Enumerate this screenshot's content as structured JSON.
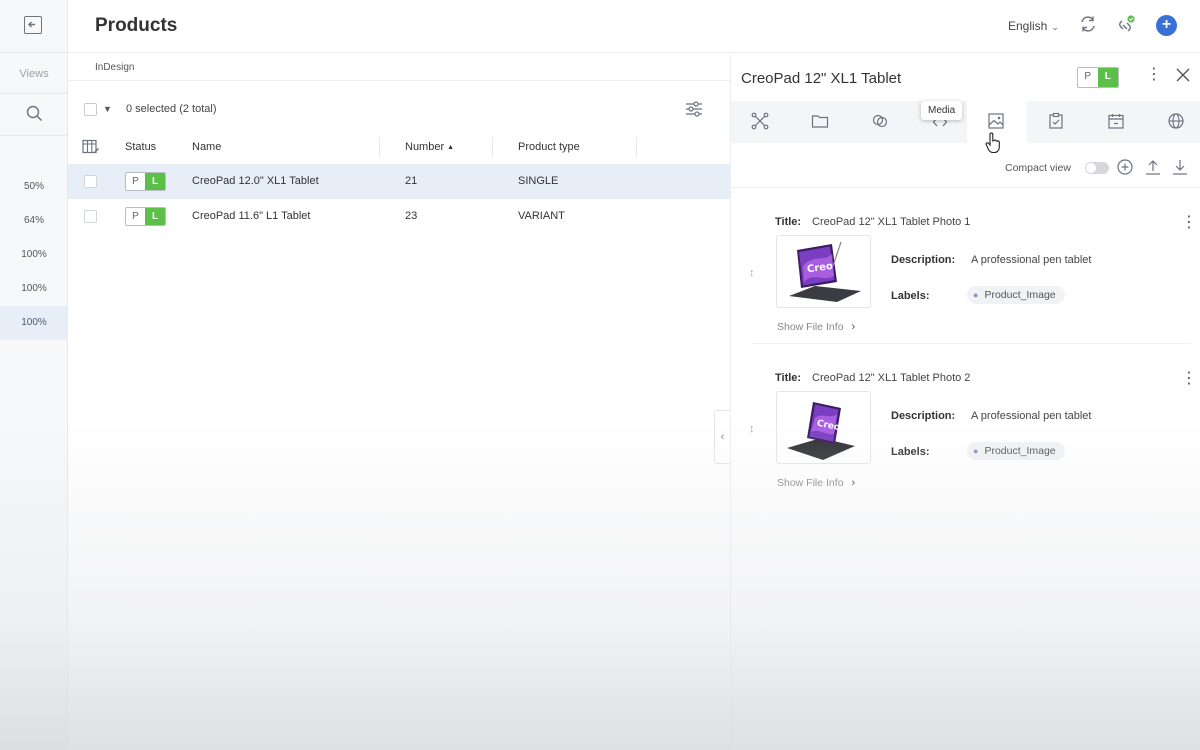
{
  "header": {
    "title": "Products",
    "language": "English"
  },
  "sidebar": {
    "views_label": "Views",
    "zoom_levels": [
      "50%",
      "64%",
      "100%",
      "100%",
      "100%"
    ]
  },
  "breadcrumb": "InDesign",
  "list": {
    "selection_text": "0 selected (2 total)",
    "columns": {
      "status": "Status",
      "name": "Name",
      "number": "Number",
      "product_type": "Product type"
    },
    "sorted_column": "number",
    "rows": [
      {
        "status_p": "P",
        "status_l": "L",
        "name": "CreoPad 12.0\" XL1 Tablet",
        "number": "21",
        "product_type": "SINGLE",
        "selected": true
      },
      {
        "status_p": "P",
        "status_l": "L",
        "name": "CreoPad 11.6\" L1 Tablet",
        "number": "23",
        "product_type": "VARIANT",
        "selected": false
      }
    ]
  },
  "panel": {
    "title": "CreoPad 12\" XL1 Tablet",
    "badge_p": "P",
    "badge_l": "L",
    "tooltip": "Media",
    "active_tab": "media",
    "compact_view_label": "Compact view",
    "compact_view_on": false,
    "media": [
      {
        "title_label": "Title:",
        "title": "CreoPad 12\" XL1 Tablet Photo 1",
        "description_label": "Description:",
        "description": "A professional pen tablet",
        "labels_label": "Labels:",
        "label": "Product_Image",
        "show_info": "Show File Info",
        "thumb_text": "Creo"
      },
      {
        "title_label": "Title:",
        "title": "CreoPad 12\" XL1 Tablet Photo 2",
        "description_label": "Description:",
        "description": "A professional pen tablet",
        "labels_label": "Labels:",
        "label": "Product_Image",
        "show_info": "Show File Info",
        "thumb_text": "Creo"
      }
    ]
  },
  "colors": {
    "accent": "#3b6fd8",
    "status_green": "#5cbf4a",
    "selected_row": "#e8eef7"
  }
}
